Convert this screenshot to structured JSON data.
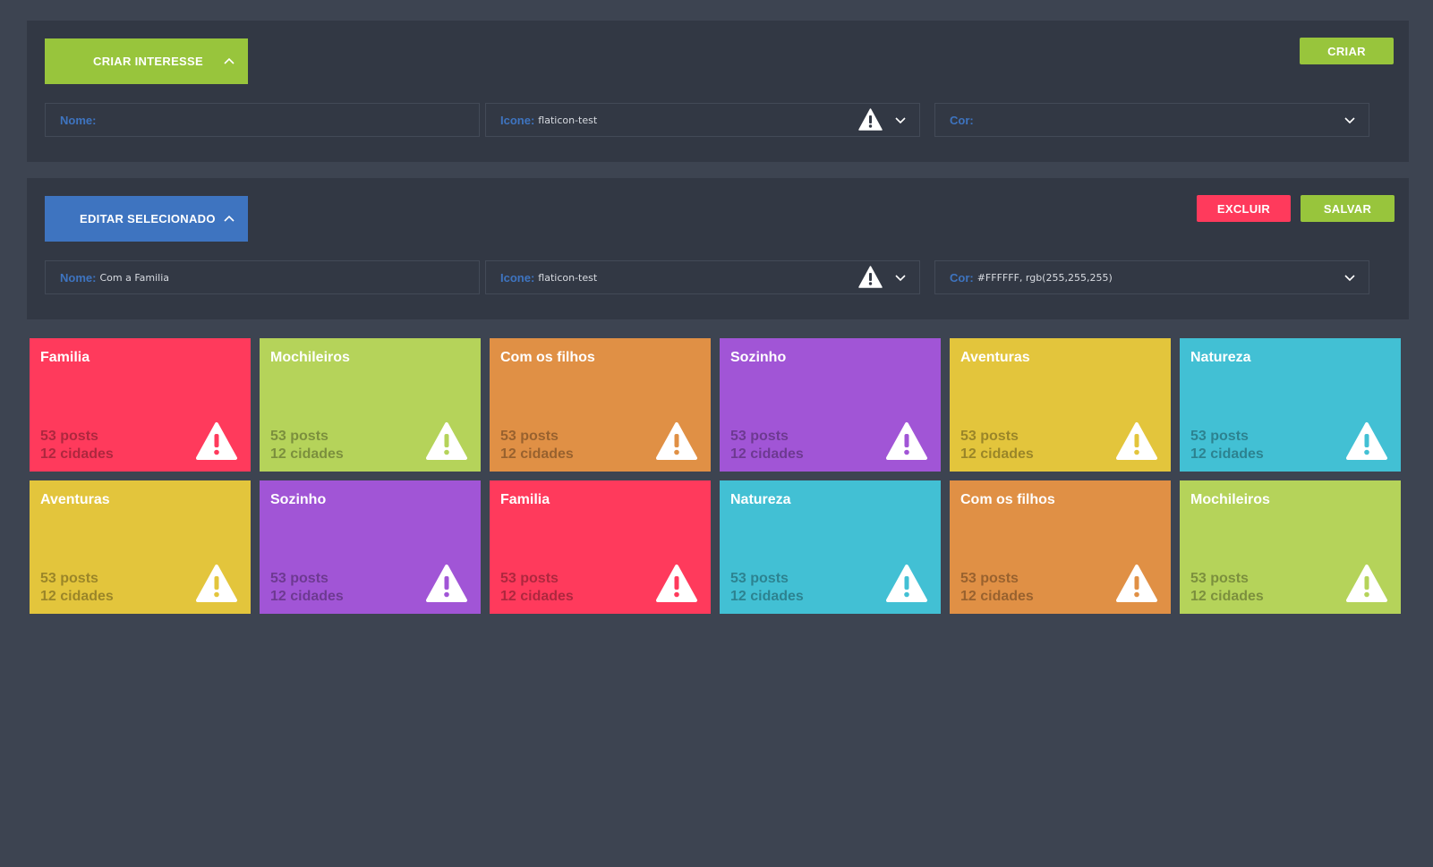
{
  "create_panel": {
    "toggle_label": "CRIAR INTERESSE",
    "action_label": "CRIAR",
    "fields": {
      "nome_label": "Nome:",
      "nome_value": "",
      "icone_label": "Icone:",
      "icone_value": "flaticon-test",
      "cor_label": "Cor:",
      "cor_value": ""
    }
  },
  "edit_panel": {
    "toggle_label": "EDITAR SELECIONADO",
    "delete_label": "EXCLUIR",
    "save_label": "SALVAR",
    "fields": {
      "nome_label": "Nome:",
      "nome_value": "Com a Familia",
      "icone_label": "Icone:",
      "icone_value": "flaticon-test",
      "cor_label": "Cor:",
      "cor_value": "#FFFFFF, rgb(255,255,255)"
    }
  },
  "colors": {
    "green": "#b5d35a",
    "red": "#ff3a5c",
    "orange": "#e09045",
    "purple": "#a155d6",
    "yellow": "#e3c53c",
    "cyan": "#42c0d4",
    "blue": "#3e74c0"
  },
  "tiles": [
    {
      "title": "Familia",
      "posts": "53 posts",
      "cities": "12 cidades",
      "color": "#ff3a5c",
      "icon": "warning-icon"
    },
    {
      "title": "Mochileiros",
      "posts": "53 posts",
      "cities": "12 cidades",
      "color": "#b5d35a",
      "icon": "warning-icon"
    },
    {
      "title": "Com os filhos",
      "posts": "53 posts",
      "cities": "12 cidades",
      "color": "#e09045",
      "icon": "warning-icon"
    },
    {
      "title": "Sozinho",
      "posts": "53 posts",
      "cities": "12 cidades",
      "color": "#a155d6",
      "icon": "warning-icon"
    },
    {
      "title": "Aventuras",
      "posts": "53 posts",
      "cities": "12 cidades",
      "color": "#e3c53c",
      "icon": "warning-icon"
    },
    {
      "title": "Natureza",
      "posts": "53 posts",
      "cities": "12 cidades",
      "color": "#42c0d4",
      "icon": "warning-icon"
    },
    {
      "title": "Aventuras",
      "posts": "53 posts",
      "cities": "12 cidades",
      "color": "#e3c53c",
      "icon": "warning-icon"
    },
    {
      "title": "Sozinho",
      "posts": "53 posts",
      "cities": "12 cidades",
      "color": "#a155d6",
      "icon": "warning-icon"
    },
    {
      "title": "Familia",
      "posts": "53 posts",
      "cities": "12 cidades",
      "color": "#ff3a5c",
      "icon": "warning-icon"
    },
    {
      "title": "Natureza",
      "posts": "53 posts",
      "cities": "12 cidades",
      "color": "#42c0d4",
      "icon": "warning-icon"
    },
    {
      "title": "Com os filhos",
      "posts": "53 posts",
      "cities": "12 cidades",
      "color": "#e09045",
      "icon": "warning-icon"
    },
    {
      "title": "Mochileiros",
      "posts": "53 posts",
      "cities": "12 cidades",
      "color": "#b5d35a",
      "icon": "warning-icon"
    }
  ]
}
